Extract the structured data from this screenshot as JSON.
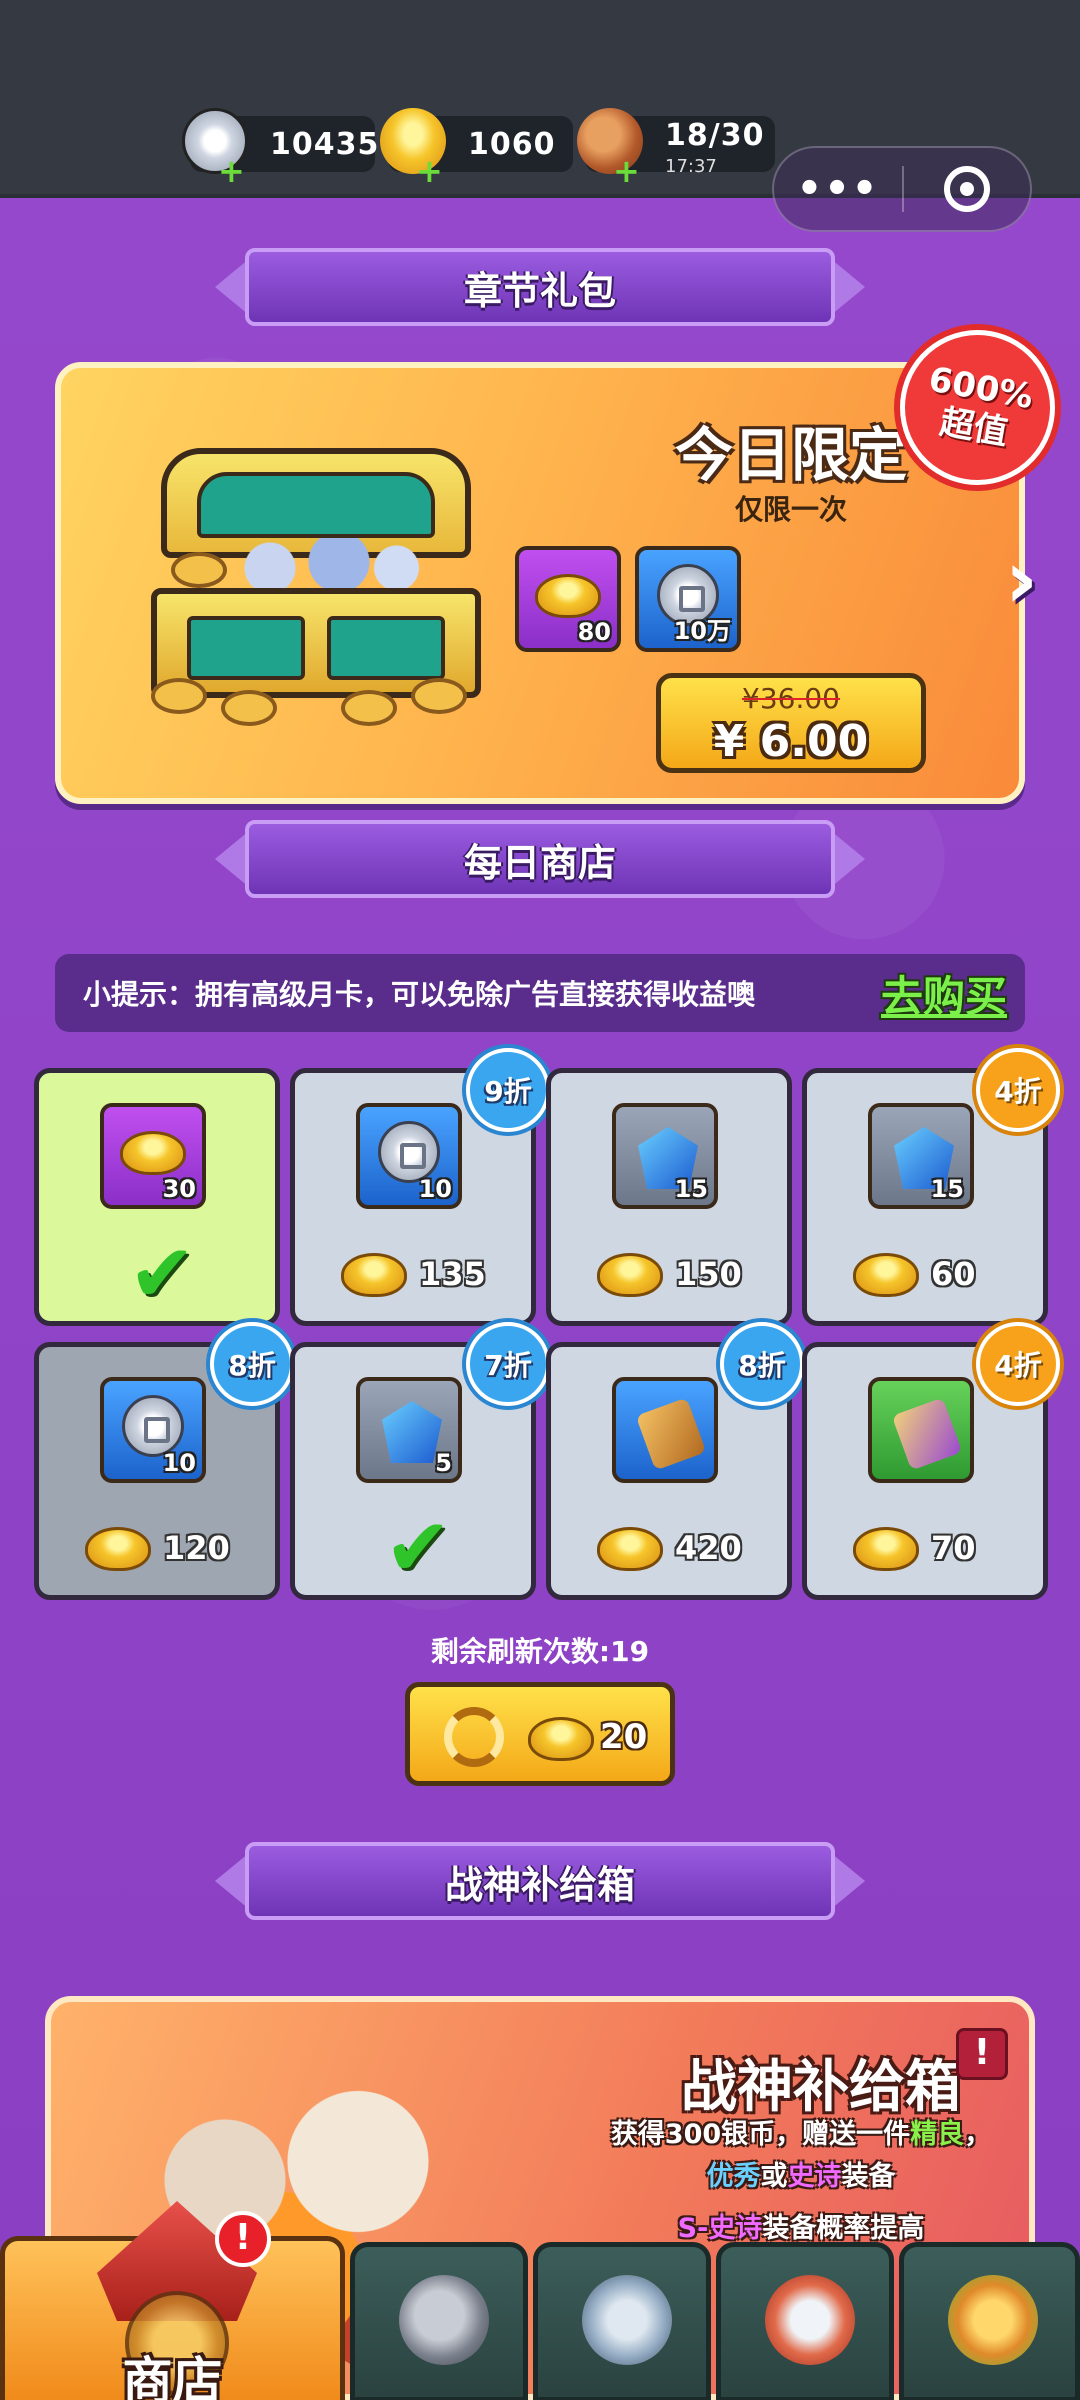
{
  "resources": [
    {
      "name": "silver-coin",
      "value": "10435"
    },
    {
      "name": "gold-ingot",
      "value": "1060"
    },
    {
      "name": "meat-stamina",
      "value": "18/30",
      "sub": "17:37"
    }
  ],
  "capsule": {
    "more": "•••"
  },
  "chapter": {
    "section_title": "章节礼包",
    "title": "今日限定",
    "subtitle": "仅限一次",
    "items": [
      {
        "kind": "gold-ingot",
        "qty": "80"
      },
      {
        "kind": "silver-coin",
        "qty": "10万"
      }
    ],
    "old_price": "¥36.00",
    "new_price": "¥ 6.00",
    "badge_line1": "600%",
    "badge_line2": "超值",
    "next_arrow": "›"
  },
  "daily_shop": {
    "section_title": "每日商店",
    "tip": "小提示：拥有高级月卡，可以免除广告直接获得收益噢",
    "tip_link": "去购买",
    "cells": [
      {
        "item": "gold-ingot",
        "qty": "30",
        "bought": true,
        "discount": "",
        "price": ""
      },
      {
        "item": "silver-coin",
        "qty": "10",
        "bought": false,
        "discount": "9折",
        "price": "135"
      },
      {
        "item": "weapon-shard",
        "qty": "15",
        "bought": false,
        "discount": "",
        "price": "150"
      },
      {
        "item": "helmet-shard",
        "qty": "15",
        "bought": false,
        "discount": "4折",
        "price": "60"
      },
      {
        "item": "silver-coin",
        "qty": "10",
        "bought": false,
        "discount": "8折",
        "price": "120"
      },
      {
        "item": "armor-shard",
        "qty": "5",
        "bought": true,
        "discount": "7折",
        "price": ""
      },
      {
        "item": "scroll",
        "qty": "",
        "bought": false,
        "discount": "8折",
        "price": "420"
      },
      {
        "item": "scroll",
        "qty": "",
        "bought": false,
        "discount": "4折",
        "price": "70"
      }
    ],
    "refresh_label": "剩余刷新次数:19",
    "refresh_cost": "20"
  },
  "supply": {
    "section_title": "战神补给箱",
    "title": "战神补给箱",
    "warn": "!",
    "desc_line1_a": "获得300银币，赠送一件",
    "desc_line1_b": "精良",
    "desc_line1_c": "，",
    "desc_line2_a": "优秀",
    "desc_line2_b": "或",
    "desc_line2_c": "史诗",
    "desc_line2_d": "装备",
    "desc_line3_a": "S-史诗",
    "desc_line3_b": "装备概率提高"
  },
  "nav": {
    "shop_label": "商店",
    "shop_alert": "!"
  },
  "colors": {
    "background": "#8b45c4",
    "accent_gold": "#f4a818",
    "link_green": "#7cf04a"
  }
}
